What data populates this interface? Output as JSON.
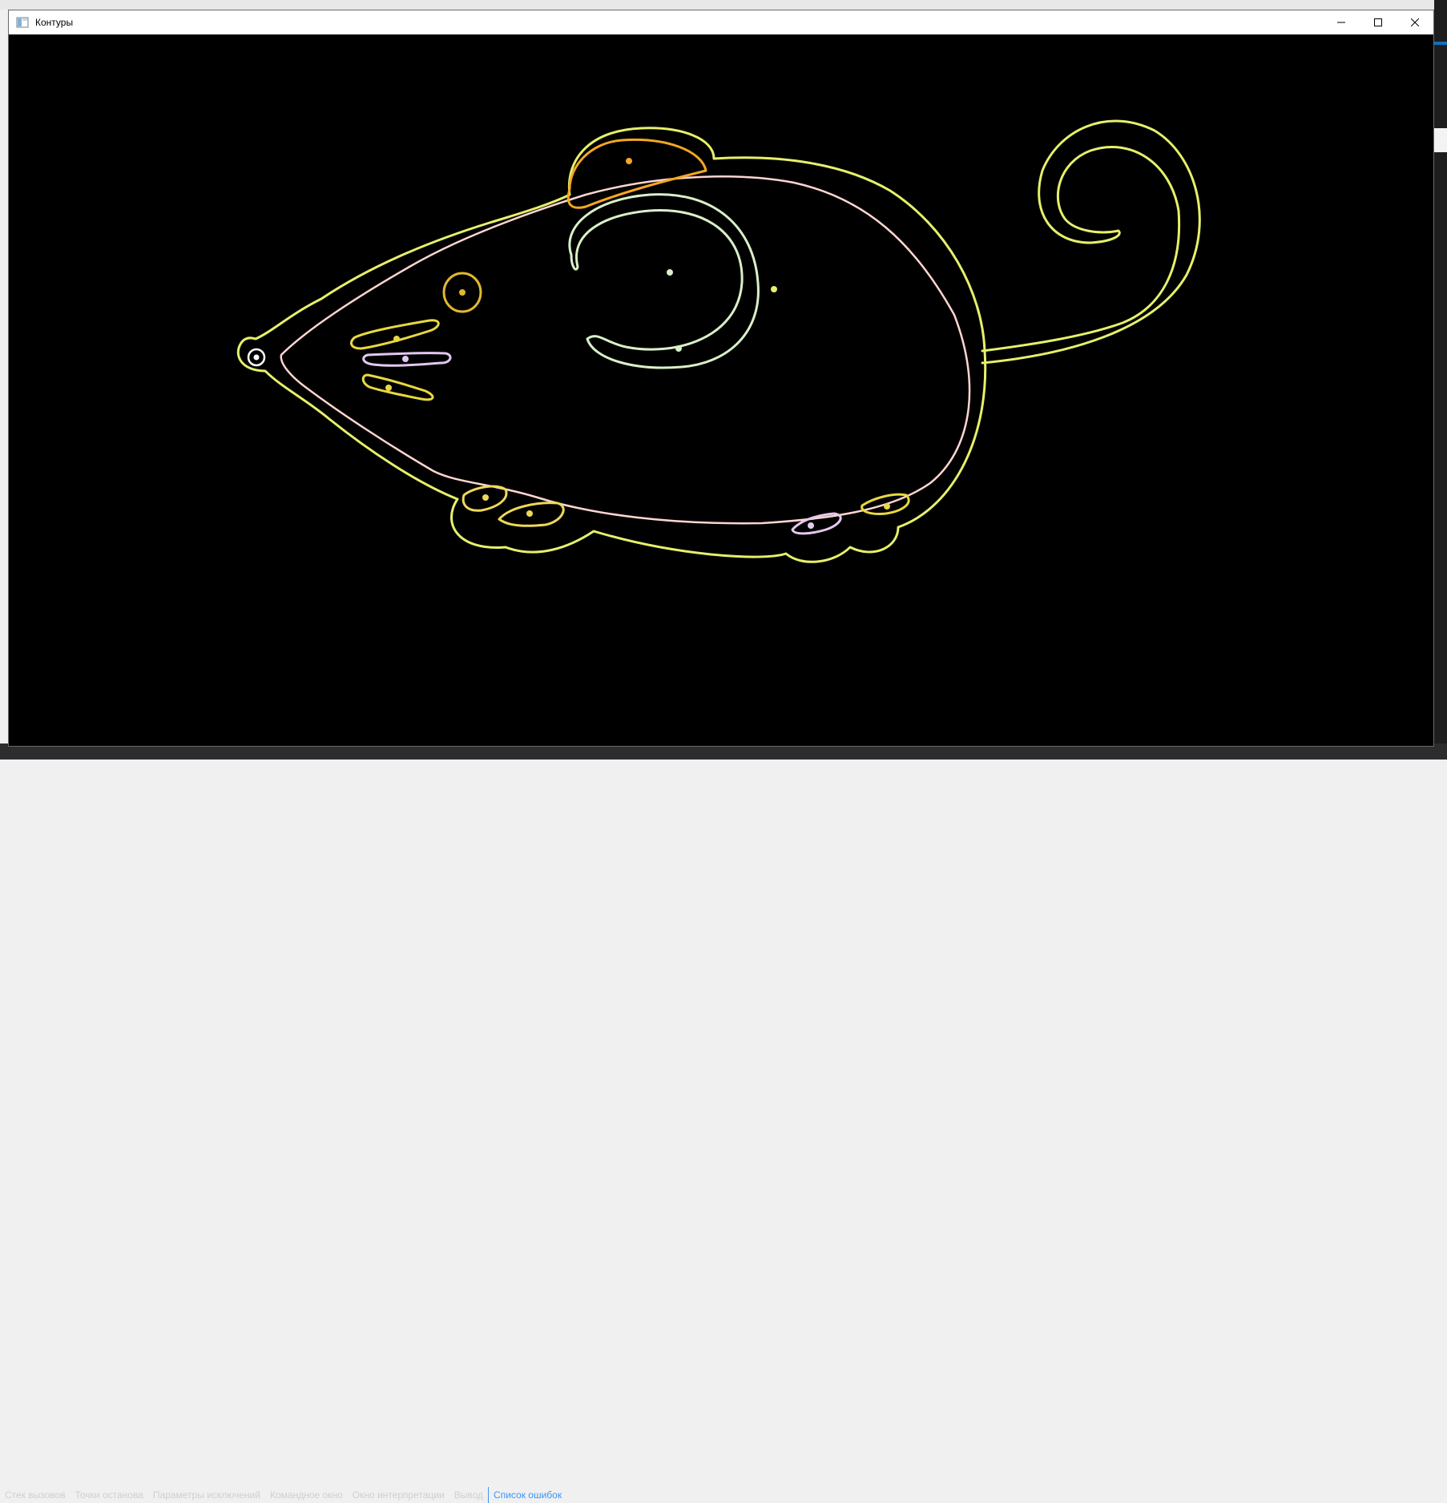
{
  "window": {
    "title": "Контуры",
    "icon": "window-app-icon",
    "controls": {
      "minimize": "minimize-icon",
      "maximize": "maximize-icon",
      "close": "close-icon"
    }
  },
  "bottom_panel": {
    "tabs": [
      "Стек вызовов",
      "Точки останова",
      "Параметры исключений",
      "Командное окно",
      "Окно интерпретации",
      "Вывод",
      "Список ошибок"
    ],
    "active_tab": "Список ошибок"
  },
  "colors": {
    "background": "#000000",
    "body_outer": "#e6f06a",
    "body_inner": "#ffd6d0",
    "ear": "#f5a623",
    "eye": "#e0b830",
    "ear_inner": "#d9f0c8",
    "whisker_top": "#e8d840",
    "whisker_mid": "#e2c8f0",
    "whisker_bottom": "#e8d840",
    "foot_yellow": "#eed85a",
    "foot_lilac": "#e6c8ee",
    "nose": "#ffffff"
  }
}
